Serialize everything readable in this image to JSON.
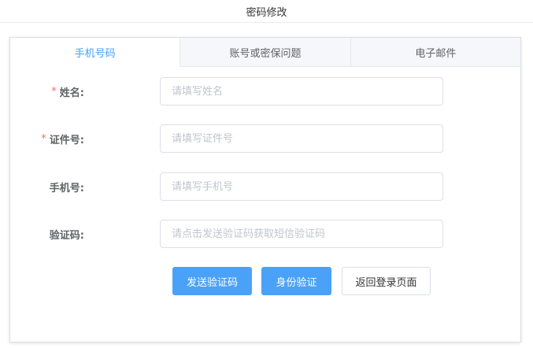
{
  "page": {
    "title": "密码修改"
  },
  "tabs": [
    {
      "label": "手机号码",
      "active": true
    },
    {
      "label": "账号或密保问题",
      "active": false
    },
    {
      "label": "电子邮件",
      "active": false
    }
  ],
  "form": {
    "required_mark": "*",
    "name": {
      "label": "姓名:",
      "placeholder": "请填写姓名",
      "value": ""
    },
    "id_number": {
      "label": "证件号:",
      "placeholder": "请填写证件号",
      "value": ""
    },
    "phone": {
      "label": "手机号:",
      "placeholder": "请填写手机号",
      "value": ""
    },
    "code": {
      "label": "验证码:",
      "placeholder": "请点击发送验证码获取短信验证码",
      "value": ""
    }
  },
  "buttons": {
    "send_code": "发送验证码",
    "verify_identity": "身份验证",
    "back_to_login": "返回登录页面"
  },
  "colors": {
    "accent": "#409eff",
    "button_primary": "#4aa2f8",
    "required": "#f56c6c"
  }
}
